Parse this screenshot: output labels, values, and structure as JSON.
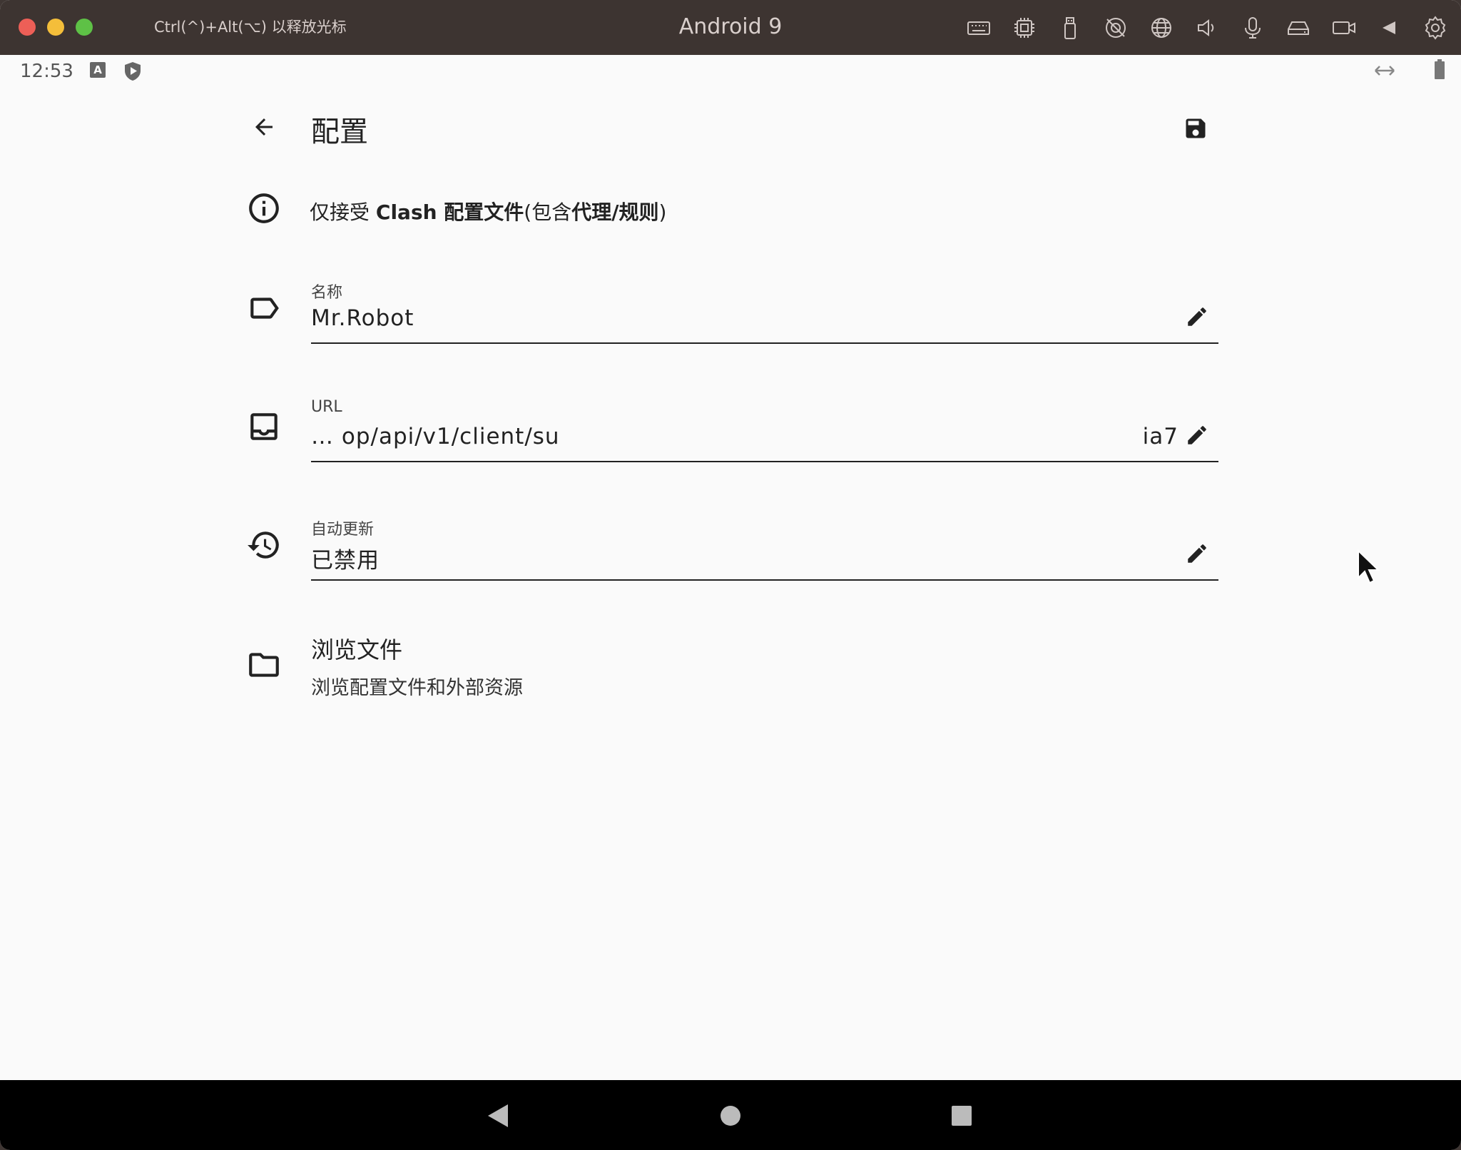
{
  "window": {
    "title": "Android 9",
    "hint": "Ctrl(^)+Alt(⌥) 以释放光标",
    "toolbar_icons": [
      "keyboard-icon",
      "cpu-icon",
      "usb-icon",
      "camera-off-icon",
      "globe-icon",
      "speaker-icon",
      "microphone-icon",
      "drive-icon",
      "video-icon",
      "back-triangle-icon",
      "gear-icon"
    ]
  },
  "statusbar": {
    "time": "12:53",
    "a_badge": "A"
  },
  "app": {
    "title": "配置",
    "info": {
      "prefix": "仅接受 ",
      "bold1": "Clash 配置文件",
      "middle": "(包含",
      "bold2": "代理/规则",
      "suffix": ")"
    },
    "name_field": {
      "label": "名称",
      "value": "Mr.Robot"
    },
    "url_field": {
      "label": "URL",
      "value_start": "…    op/api/v1/client/su",
      "value_end": "ia7"
    },
    "auto_update_field": {
      "label": "自动更新",
      "value": "已禁用"
    },
    "browse": {
      "title": "浏览文件",
      "subtitle": "浏览配置文件和外部资源"
    }
  },
  "colors": {
    "titlebar": "#3d3431",
    "background": "#fafafa",
    "text": "#222222"
  }
}
